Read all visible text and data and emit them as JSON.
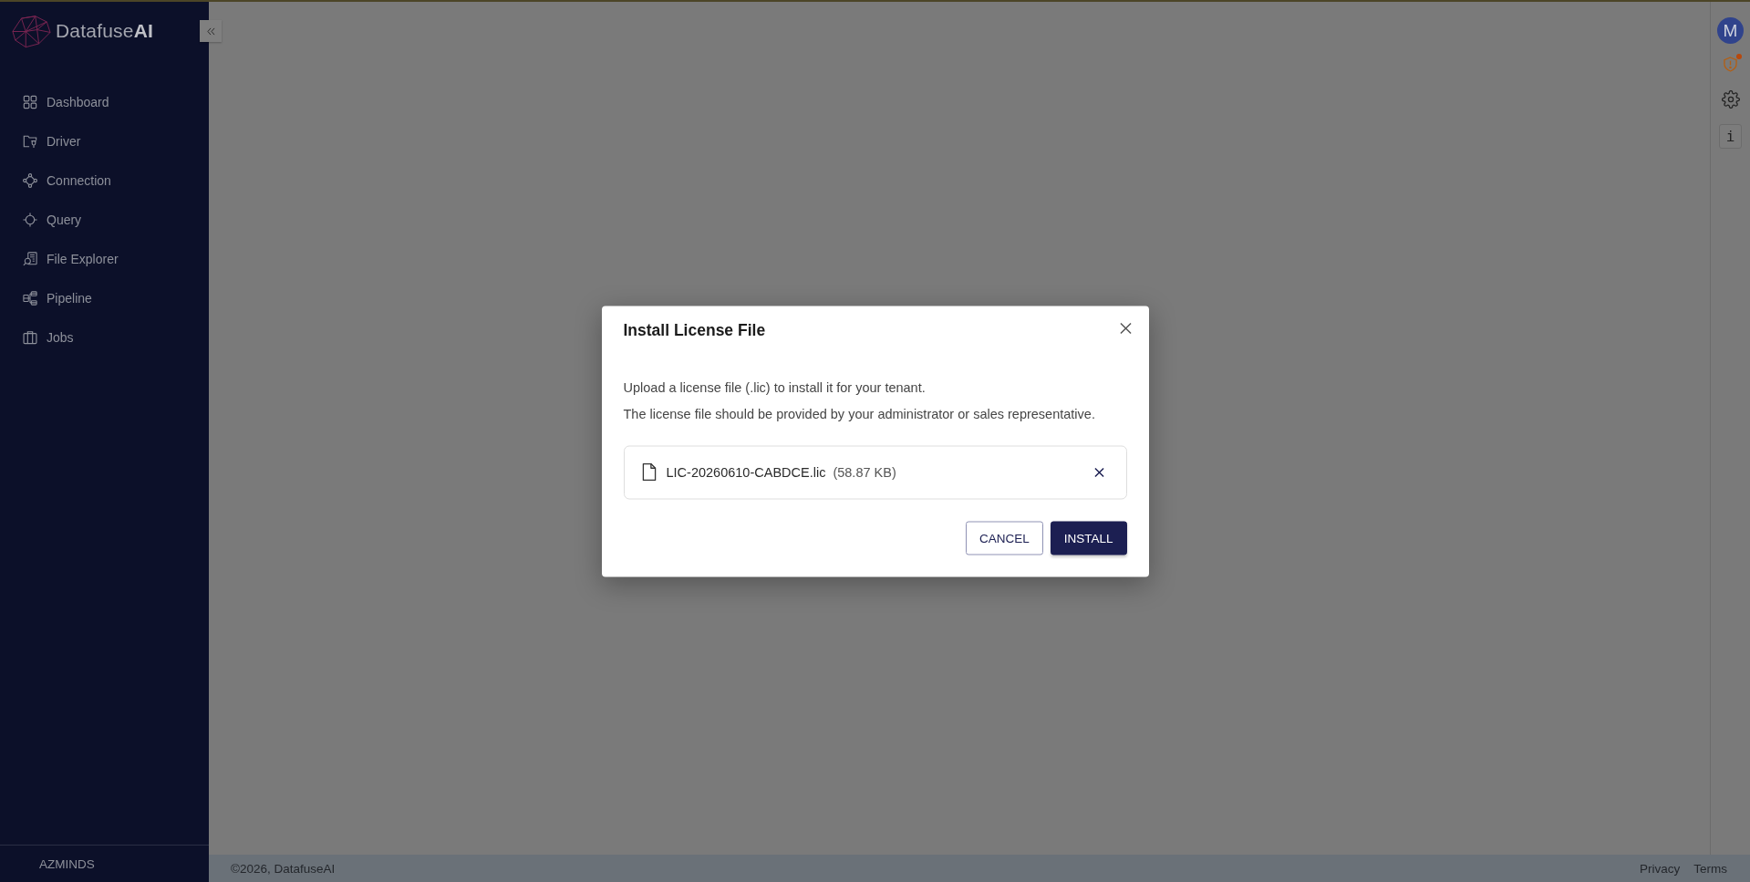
{
  "sidebar": {
    "brand": "Datafuse**AI**",
    "nav": [
      {
        "label": "Dashboard",
        "selected": false
      },
      {
        "label": "Driver",
        "selected": false
      },
      {
        "label": "Connection",
        "selected": false
      },
      {
        "label": "Query",
        "selected": false
      },
      {
        "label": "File Explorer",
        "selected": false
      },
      {
        "label": "Pipeline",
        "selected": false
      },
      {
        "label": "Jobs",
        "selected": false
      }
    ],
    "org": "AZMINDS"
  },
  "rail": {
    "avatar": "M",
    "license_alert": true,
    "info": "i"
  },
  "dialog": {
    "title": "Install License File",
    "paragraphs": [
      "Upload a license file (.lic) to install it for your tenant.",
      "The license file should be provided by your administrator or sales representative."
    ],
    "file": {
      "name": "LIC-20260610-CABDCE.lic",
      "size": "(58.87 KB)"
    },
    "buttons": [
      {
        "label": "CANCEL",
        "kind": "secondary"
      },
      {
        "label": "INSTALL",
        "kind": "primary"
      }
    ]
  },
  "footer": {
    "copyright": "©2026, DatafuseAI",
    "links": [
      "Privacy",
      "Terms"
    ]
  }
}
